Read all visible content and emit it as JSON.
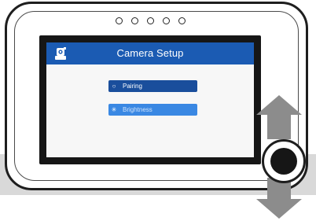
{
  "device": {
    "led_count": 5
  },
  "screen": {
    "title": "Camera Setup",
    "icon": "camera-icon",
    "menu": [
      {
        "label": "Pairing",
        "bullet": "○",
        "selected": true
      },
      {
        "label": "Brightness",
        "bullet": "✳",
        "selected": false
      }
    ]
  },
  "controls": {
    "knob_icon": "dial-knob",
    "up_arrow_icon": "arrow-up-icon",
    "down_arrow_icon": "arrow-down-icon"
  },
  "colors": {
    "title_bar": "#1b5bb3",
    "selected_item": "#1a4e9c",
    "normal_item": "#3a88e3",
    "arrow": "#8c8c8c",
    "floor": "#d9d9d9"
  }
}
